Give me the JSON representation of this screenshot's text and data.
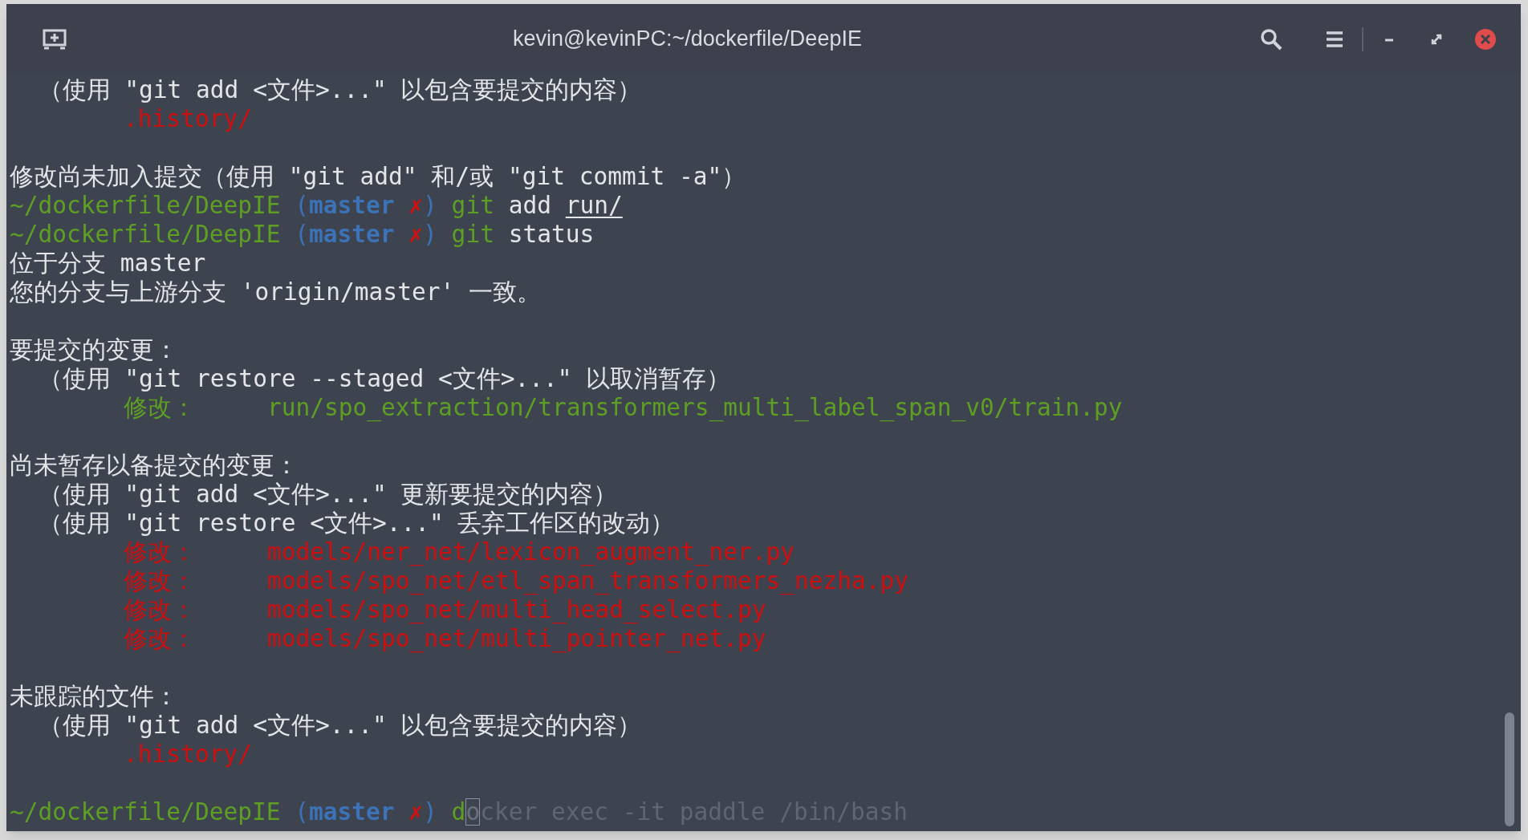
{
  "window": {
    "title": "kevin@kevinPC:~/dockerfile/DeepIE"
  },
  "lines": [
    {
      "kind": "text",
      "segments": [
        {
          "text": "  （使用 \"git add <文件>...\" 以包含要提交的内容）",
          "kind": "plain"
        }
      ]
    },
    {
      "kind": "text",
      "segments": [
        {
          "text": "        .history/",
          "kind": "untracked"
        }
      ]
    },
    {
      "kind": "blank"
    },
    {
      "kind": "text",
      "segments": [
        {
          "text": "修改尚未加入提交（使用 \"git add\" 和/或 \"git commit -a\"）",
          "kind": "plain"
        }
      ]
    },
    {
      "kind": "prompt",
      "segments": [
        {
          "text": "~/dockerfile/DeepIE ",
          "kind": "path"
        },
        {
          "text": "(",
          "kind": "branch"
        },
        {
          "text": "master",
          "kind": "branchname"
        },
        {
          "text": " ✗",
          "kind": "dirty"
        },
        {
          "text": ")",
          "kind": "branch"
        },
        {
          "text": " git",
          "kind": "command"
        },
        {
          "text": " add ",
          "kind": "plain"
        },
        {
          "text": "run/",
          "kind": "argument"
        }
      ]
    },
    {
      "kind": "prompt",
      "segments": [
        {
          "text": "~/dockerfile/DeepIE ",
          "kind": "path"
        },
        {
          "text": "(",
          "kind": "branch"
        },
        {
          "text": "master",
          "kind": "branchname"
        },
        {
          "text": " ✗",
          "kind": "dirty"
        },
        {
          "text": ")",
          "kind": "branch"
        },
        {
          "text": " git",
          "kind": "command"
        },
        {
          "text": " status",
          "kind": "plain"
        }
      ]
    },
    {
      "kind": "text",
      "segments": [
        {
          "text": "位于分支 master",
          "kind": "plain"
        }
      ]
    },
    {
      "kind": "text",
      "segments": [
        {
          "text": "您的分支与上游分支 'origin/master' 一致。",
          "kind": "plain"
        }
      ]
    },
    {
      "kind": "blank"
    },
    {
      "kind": "text",
      "segments": [
        {
          "text": "要提交的变更：",
          "kind": "plain"
        }
      ]
    },
    {
      "kind": "text",
      "segments": [
        {
          "text": "  （使用 \"git restore --staged <文件>...\" 以取消暂存）",
          "kind": "plain"
        }
      ]
    },
    {
      "kind": "text",
      "segments": [
        {
          "text": "        修改：     run/spo_extraction/transformers_multi_label_span_v0/train.py",
          "kind": "staged"
        }
      ]
    },
    {
      "kind": "blank"
    },
    {
      "kind": "text",
      "segments": [
        {
          "text": "尚未暂存以备提交的变更：",
          "kind": "plain"
        }
      ]
    },
    {
      "kind": "text",
      "segments": [
        {
          "text": "  （使用 \"git add <文件>...\" 更新要提交的内容）",
          "kind": "plain"
        }
      ]
    },
    {
      "kind": "text",
      "segments": [
        {
          "text": "  （使用 \"git restore <文件>...\" 丢弃工作区的改动）",
          "kind": "plain"
        }
      ]
    },
    {
      "kind": "text",
      "segments": [
        {
          "text": "        修改：     models/ner_net/lexicon_augment_ner.py",
          "kind": "unstaged"
        }
      ]
    },
    {
      "kind": "text",
      "segments": [
        {
          "text": "        修改：     models/spo_net/etl_span_transformers_nezha.py",
          "kind": "unstaged"
        }
      ]
    },
    {
      "kind": "text",
      "segments": [
        {
          "text": "        修改：     models/spo_net/multi_head_select.py",
          "kind": "unstaged"
        }
      ]
    },
    {
      "kind": "text",
      "segments": [
        {
          "text": "        修改：     models/spo_net/multi_pointer_net.py",
          "kind": "unstaged"
        }
      ]
    },
    {
      "kind": "blank"
    },
    {
      "kind": "text",
      "segments": [
        {
          "text": "未跟踪的文件：",
          "kind": "plain"
        }
      ]
    },
    {
      "kind": "text",
      "segments": [
        {
          "text": "  （使用 \"git add <文件>...\" 以包含要提交的内容）",
          "kind": "plain"
        }
      ]
    },
    {
      "kind": "text",
      "segments": [
        {
          "text": "        .history/",
          "kind": "untracked"
        }
      ]
    },
    {
      "kind": "blank"
    },
    {
      "kind": "prompt",
      "segments": [
        {
          "text": "~/dockerfile/DeepIE ",
          "kind": "path"
        },
        {
          "text": "(",
          "kind": "branch"
        },
        {
          "text": "master",
          "kind": "branchname"
        },
        {
          "text": " ✗",
          "kind": "dirty"
        },
        {
          "text": ")",
          "kind": "branch"
        },
        {
          "text": " d",
          "kind": "command"
        },
        {
          "text": "o",
          "kind": "cursor"
        },
        {
          "text": "cker exec -it paddle /bin/bash",
          "kind": "suggestion"
        }
      ]
    }
  ]
}
